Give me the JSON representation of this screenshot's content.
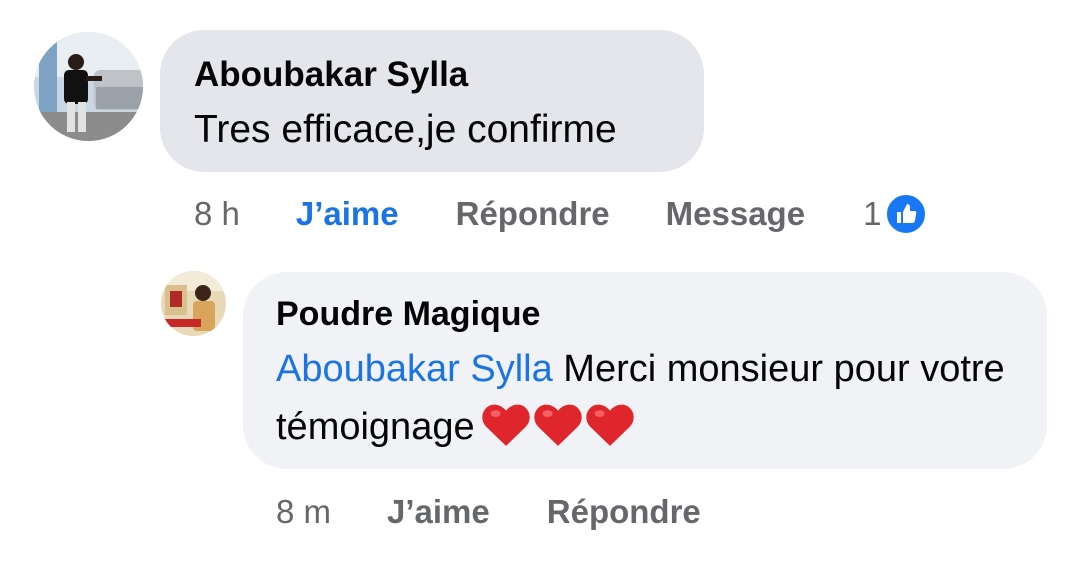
{
  "comments": [
    {
      "author": "Aboubakar Sylla",
      "text": "Tres efficace,je confirme",
      "time": "8 h",
      "like_label": "J’aime",
      "reply_label": "Répondre",
      "message_label": "Message",
      "reaction_count": "1",
      "reaction_icon": "like-icon",
      "like_active": true
    },
    {
      "author": "Poudre Magique",
      "mention": "Aboubakar Sylla",
      "text": "Merci monsieur pour votre témoignage",
      "emoji": [
        "heart",
        "heart",
        "heart"
      ],
      "time": "8 m",
      "like_label": "J’aime",
      "reply_label": "Répondre",
      "like_active": false,
      "avatar_overlay_text": "Poudre Magique"
    }
  ],
  "colors": {
    "link_blue": "#1b74e4",
    "secondary_text": "#65676b",
    "bubble_main": "#e4e6eb",
    "bubble_reply": "#f0f2f5",
    "heart_red": "#e0262d",
    "like_badge": "#1877f2"
  }
}
